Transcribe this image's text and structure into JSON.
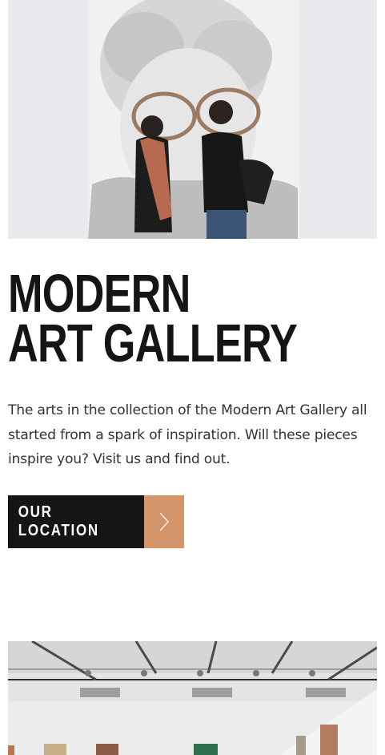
{
  "hero": {
    "title_line1": "MODERN",
    "title_line2": "ART GALLERY",
    "description": "The arts in the collection of the Modern Art Gallery all started from a spark of inspiration. Will these pieces inspire you? Visit us and find out.",
    "cta_label": "OUR LOCATION",
    "cta_icon": "chevron-right-icon"
  },
  "colors": {
    "title": "#151515",
    "button_dark": "#151515",
    "button_accent": "#d4956a",
    "body_text": "#333333"
  }
}
